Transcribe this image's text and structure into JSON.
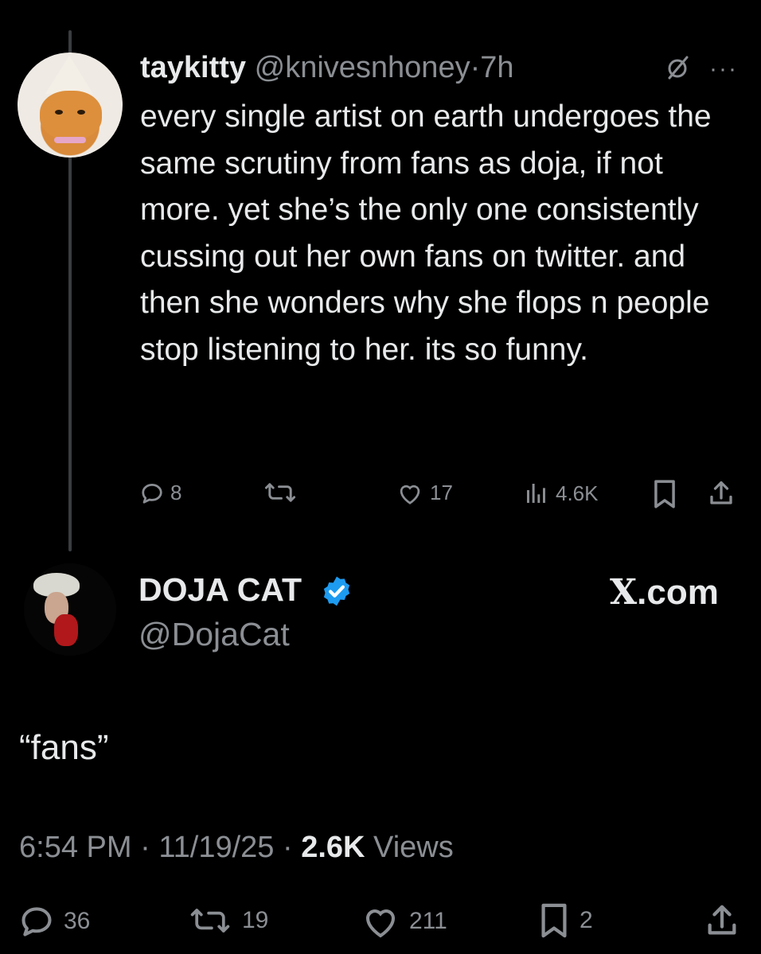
{
  "quoted_tweet": {
    "display_name": "taykitty",
    "handle": "@knivesnhoney",
    "separator": "·",
    "time": "7h",
    "text": "every single artist on earth undergoes the same scrutiny from fans as doja, if not more. yet she’s the only one consistently cussing out her own fans on twitter. and then she wonders why she flops n people stop listening to her. its so funny.",
    "actions": {
      "replies": "8",
      "reposts": "",
      "likes": "17",
      "views": "4.6K"
    }
  },
  "main_tweet": {
    "display_name": "DOJA CAT",
    "handle": "@DojaCat",
    "verified_color": "#1d9bf0",
    "watermark": "X.com",
    "watermark_x": "X",
    "watermark_rest": ".com",
    "text": "“fans”",
    "time": "6:54 PM",
    "date": "11/19/25",
    "separator": "·",
    "views_count": "2.6K",
    "views_label": "Views",
    "actions": {
      "replies": "36",
      "reposts": "19",
      "likes": "211",
      "bookmarks": "2"
    }
  },
  "icons": [
    "grok-icon",
    "more-icon",
    "reply-icon",
    "repost-icon",
    "like-icon",
    "views-icon",
    "bookmark-icon",
    "share-icon",
    "verified-badge-icon"
  ]
}
